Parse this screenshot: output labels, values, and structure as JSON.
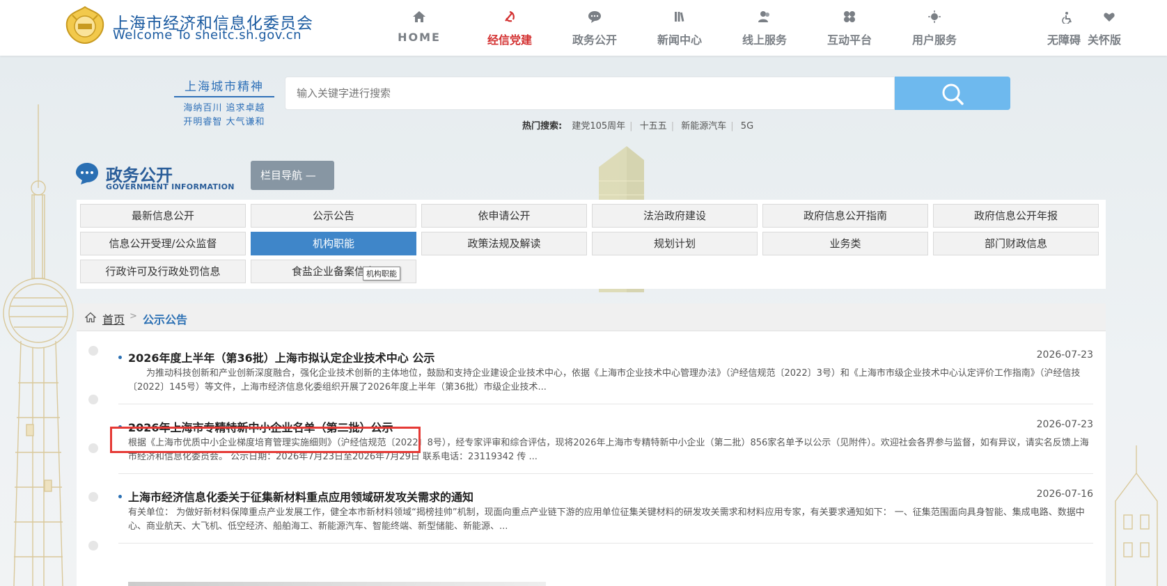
{
  "header": {
    "title": "上海市经济和信息化委员会",
    "subtitle": "Welcome To sheitc.sh.gov.cn"
  },
  "nav": [
    {
      "label": "HOME",
      "icon": "home-icon"
    },
    {
      "label": "经信党建",
      "icon": "party-emblem-icon",
      "active": true
    },
    {
      "label": "政务公开",
      "icon": "chat-icon"
    },
    {
      "label": "新闻中心",
      "icon": "books-icon"
    },
    {
      "label": "线上服务",
      "icon": "users-icon"
    },
    {
      "label": "互动平台",
      "icon": "grid-icon"
    },
    {
      "label": "用户服务",
      "icon": "sparkle-icon"
    }
  ],
  "util": {
    "accessibility": "无障碍",
    "care": "关怀版"
  },
  "slogan": {
    "title": "上海城市精神",
    "line1": "海纳百川 追求卓越",
    "line2": "开明睿智 大气谦和"
  },
  "search": {
    "placeholder": "输入关键字进行搜索",
    "hot_label": "热门搜索:",
    "hot_items": [
      "建党105周年",
      "十五五",
      "新能源汽车",
      "5G"
    ]
  },
  "section": {
    "title": "政务公开",
    "en": "GOVERNMENT INFORMATION",
    "nav_btn": "栏目导航  —"
  },
  "categories": [
    "最新信息公开",
    "公示公告",
    "依申请公开",
    "法治政府建设",
    "政府信息公开指南",
    "政府信息公开年报",
    "信息公开受理/公众监督",
    "机构职能",
    "政策法规及解读",
    "规划计划",
    "业务类",
    "部门财政信息",
    "行政许可及行政处罚信息",
    "食盐企业备案信息"
  ],
  "tooltip": "机构职能",
  "breadcrumb": {
    "home": "首页",
    "sep": ">",
    "current": "公示公告"
  },
  "articles": [
    {
      "title": "2026年度上半年（第36批）上海市拟认定企业技术中心 公示",
      "date": "2026-07-23",
      "desc": "为推动科技创新和产业创新深度融合，强化企业技术创新的主体地位，鼓励和支持企业建设企业技术中心，依据《上海市企业技术中心管理办法》（沪经信规范〔2022〕3号）和《上海市市级企业技术中心认定评价工作指南》（沪经信技〔2022〕145号）等文件，上海市经济信息化委组织开展了2026年度上半年（第36批）市级企业技术..."
    },
    {
      "title": "2026年上海市专精特新中小企业名单（第二批）公示",
      "date": "2026-07-23",
      "desc": "根据《上海市优质中小企业梯度培育管理实施细则》（沪经信规范〔2022〕8号），经专家评审和综合评估，现将2026年上海市专精特新中小企业（第二批）856家名单予以公示（见附件）。欢迎社会各界参与监督，如有异议，请实名反馈上海市经济和信息化委员会。 公示日期：2026年7月23日至2026年7月29日 联系电话：23119342 传 ..."
    },
    {
      "title": "上海市经济信息化委关于征集新材料重点应用领域研发攻关需求的通知",
      "date": "2026-07-16",
      "desc": "有关单位： 为做好新材料保障重点产业发展工作，健全本市新材料领域“揭榜挂帅”机制，现面向重点产业链下游的应用单位征集关键材料的研发攻关需求和材料应用专家，有关要求通知如下： 一、征集范围面向具身智能、集成电路、数据中心、商业航天、大飞机、低空经济、船舶海工、新能源汽车、智能终端、新型储能、新能源、..."
    }
  ]
}
